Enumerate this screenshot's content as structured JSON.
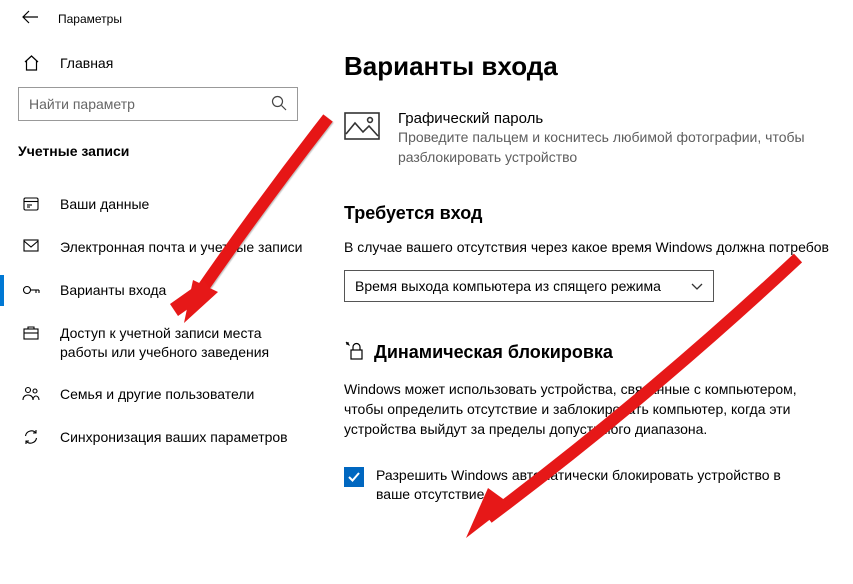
{
  "window": {
    "title": "Параметры"
  },
  "sidebar": {
    "home": "Главная",
    "search_placeholder": "Найти параметр",
    "category": "Учетные записи",
    "items": [
      {
        "label": "Ваши данные"
      },
      {
        "label": "Электронная почта и учетные записи"
      },
      {
        "label": "Варианты входа"
      },
      {
        "label": "Доступ к учетной записи места работы или учебного заведения"
      },
      {
        "label": "Семья и другие пользователи"
      },
      {
        "label": "Синхронизация ваших параметров"
      }
    ]
  },
  "main": {
    "heading": "Варианты входа",
    "picture_password": {
      "title": "Графический пароль",
      "desc": "Проведите пальцем и коснитесь любимой фотографии, чтобы разблокировать устройство"
    },
    "require_signin": {
      "title": "Требуется вход",
      "desc": "В случае вашего отсутствия через какое время Windows должна потребов",
      "select_value": "Время выхода компьютера из спящего режима"
    },
    "dynamic_lock": {
      "title": "Динамическая блокировка",
      "desc": "Windows может использовать устройства, связанные с компьютером, чтобы определить отсутствие и заблокировать компьютер, когда эти устройства выйдут за пределы допустимого диапазона.",
      "checkbox_label": "Разрешить Windows автоматически блокировать устройство в ваше отсутствие"
    }
  }
}
